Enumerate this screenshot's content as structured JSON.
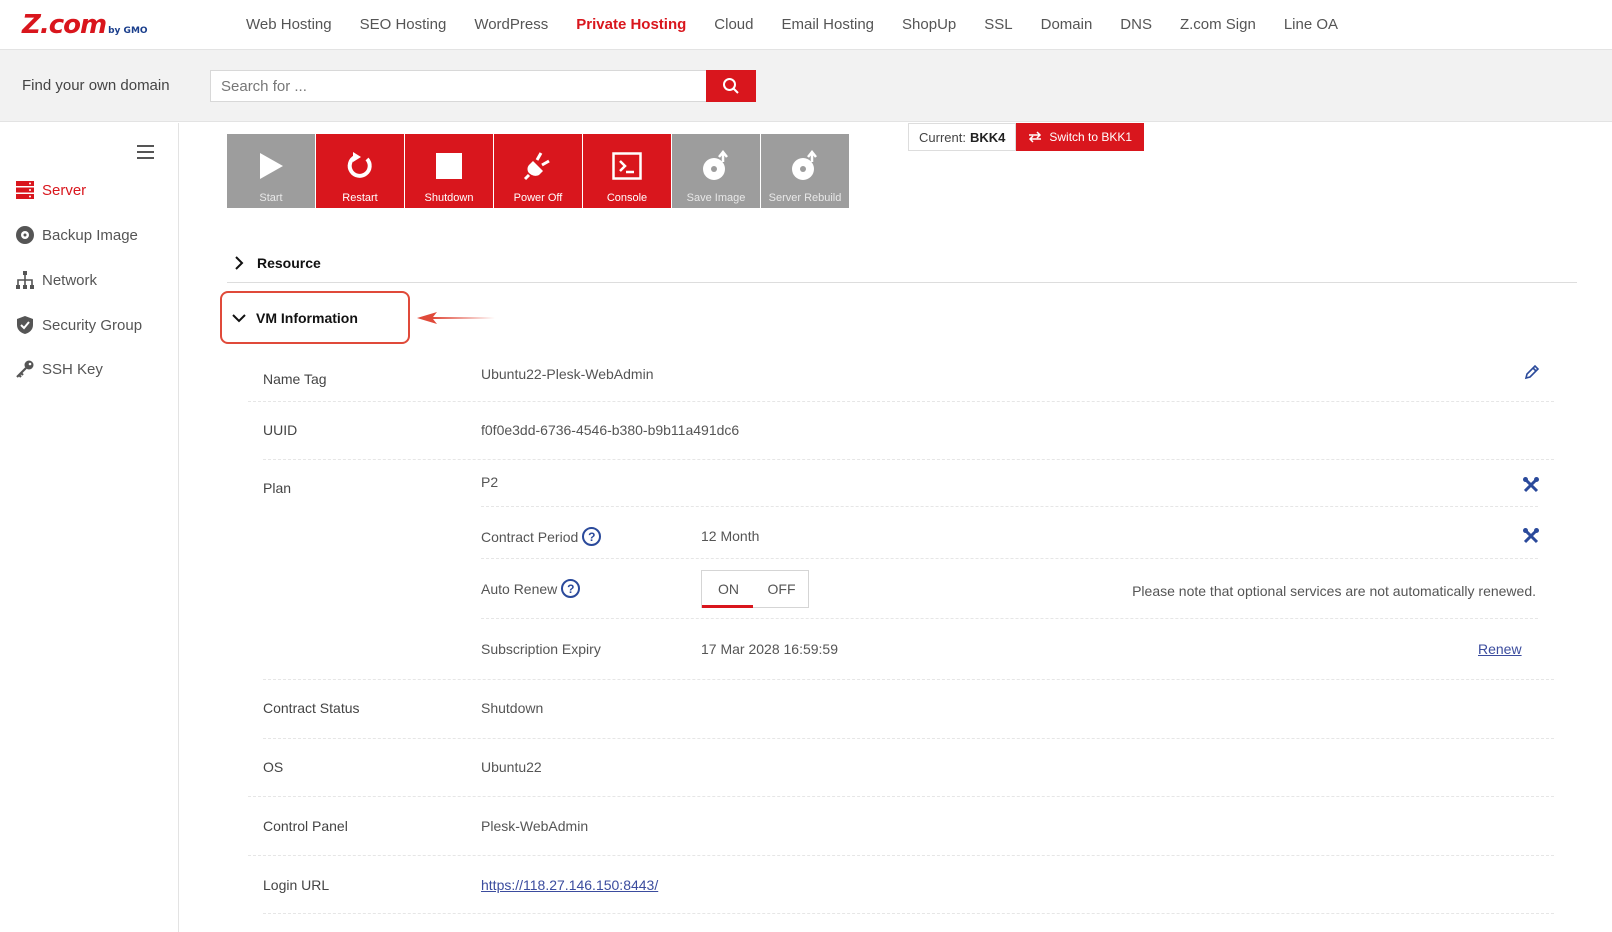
{
  "header": {
    "logo_text": "Z.com",
    "logo_sub": "by GMO",
    "nav": [
      {
        "label": "Web Hosting",
        "active": false
      },
      {
        "label": "SEO Hosting",
        "active": false
      },
      {
        "label": "WordPress",
        "active": false
      },
      {
        "label": "Private Hosting",
        "active": true
      },
      {
        "label": "Cloud",
        "active": false
      },
      {
        "label": "Email Hosting",
        "active": false
      },
      {
        "label": "ShopUp",
        "active": false
      },
      {
        "label": "SSL",
        "active": false
      },
      {
        "label": "Domain",
        "active": false
      },
      {
        "label": "DNS",
        "active": false
      },
      {
        "label": "Z.com Sign",
        "active": false
      },
      {
        "label": "Line OA",
        "active": false
      }
    ]
  },
  "search": {
    "label": "Find your own domain",
    "placeholder": "Search for ..."
  },
  "sidebar": {
    "items": [
      {
        "label": "Server",
        "icon": "server-icon",
        "active": true
      },
      {
        "label": "Backup Image",
        "icon": "backup-icon",
        "active": false
      },
      {
        "label": "Network",
        "icon": "network-icon",
        "active": false
      },
      {
        "label": "Security Group",
        "icon": "shield-icon",
        "active": false
      },
      {
        "label": "SSH Key",
        "icon": "key-icon",
        "active": false
      }
    ]
  },
  "toolbar": {
    "buttons": [
      {
        "label": "Start",
        "icon": "play-icon",
        "enabled": false
      },
      {
        "label": "Restart",
        "icon": "restart-icon",
        "enabled": true
      },
      {
        "label": "Shutdown",
        "icon": "stop-icon",
        "enabled": true
      },
      {
        "label": "Power Off",
        "icon": "plug-icon",
        "enabled": true
      },
      {
        "label": "Console",
        "icon": "console-icon",
        "enabled": true
      },
      {
        "label": "Save Image",
        "icon": "disk-icon",
        "enabled": false
      },
      {
        "label": "Server Rebuild",
        "icon": "rebuild-icon",
        "enabled": false
      }
    ]
  },
  "region": {
    "current_label": "Current:",
    "current_value": "BKK4",
    "switch_label": "Switch to BKK1"
  },
  "sections": {
    "resource": "Resource",
    "vm_info": "VM Information"
  },
  "vm_info": {
    "name_tag_label": "Name Tag",
    "name_tag_value": "Ubuntu22-Plesk-WebAdmin",
    "uuid_label": "UUID",
    "uuid_value": "f0f0e3dd-6736-4546-b380-b9b11a491dc6",
    "plan_label": "Plan",
    "plan_value": "P2",
    "contract_period_label": "Contract Period",
    "contract_period_value": "12 Month",
    "auto_renew_label": "Auto Renew",
    "auto_renew_on": "ON",
    "auto_renew_off": "OFF",
    "auto_renew_note": "Please note that optional services are not automatically renewed.",
    "expiry_label": "Subscription Expiry",
    "expiry_value": "17 Mar 2028 16:59:59",
    "renew_link": "Renew",
    "contract_status_label": "Contract Status",
    "contract_status_value": "Shutdown",
    "os_label": "OS",
    "os_value": "Ubuntu22",
    "control_panel_label": "Control Panel",
    "control_panel_value": "Plesk-WebAdmin",
    "login_url_label": "Login URL",
    "login_url_value": "https://118.27.146.150:8443/"
  },
  "colors": {
    "brand_red": "#d9161d",
    "highlight_red": "#e04a3a",
    "disabled_gray": "#9d9d9d",
    "link_blue": "#3b4c9e"
  }
}
